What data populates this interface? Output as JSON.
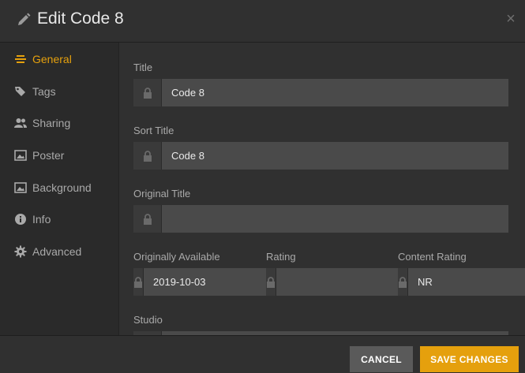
{
  "header": {
    "title": "Edit Code 8",
    "close_label": "×"
  },
  "sidebar": {
    "items": [
      {
        "label": "General",
        "icon": "lines-icon",
        "active": true
      },
      {
        "label": "Tags",
        "icon": "tag-icon"
      },
      {
        "label": "Sharing",
        "icon": "users-icon"
      },
      {
        "label": "Poster",
        "icon": "image-icon"
      },
      {
        "label": "Background",
        "icon": "image-icon"
      },
      {
        "label": "Info",
        "icon": "info-icon"
      },
      {
        "label": "Advanced",
        "icon": "gear-icon"
      }
    ]
  },
  "form": {
    "title": {
      "label": "Title",
      "value": "Code 8"
    },
    "sort_title": {
      "label": "Sort Title",
      "value": "Code 8"
    },
    "original_title": {
      "label": "Original Title",
      "value": ""
    },
    "originally_available": {
      "label": "Originally Available",
      "value": "2019-10-03"
    },
    "rating": {
      "label": "Rating",
      "value": ""
    },
    "content_rating": {
      "label": "Content Rating",
      "value": "NR"
    },
    "studio": {
      "label": "Studio",
      "value": ""
    }
  },
  "footer": {
    "cancel_label": "CANCEL",
    "save_label": "SAVE CHANGES"
  },
  "colors": {
    "accent": "#e5a00d",
    "background": "#303030",
    "input": "#4a4a4a"
  }
}
